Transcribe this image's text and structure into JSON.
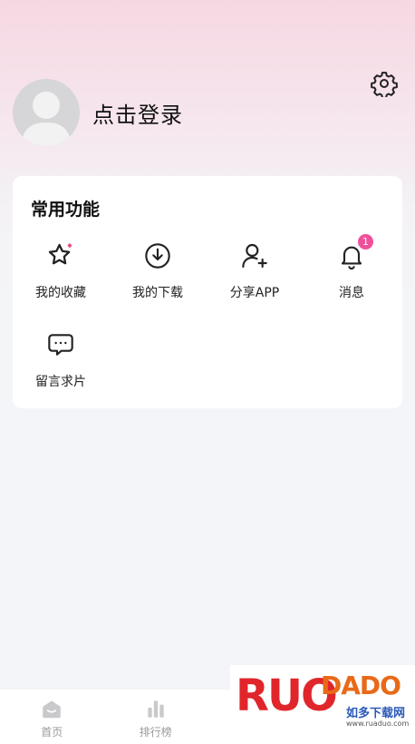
{
  "profile": {
    "login_text": "点击登录"
  },
  "common": {
    "title": "常用功能",
    "items": [
      {
        "label": "我的收藏",
        "icon": "star-icon"
      },
      {
        "label": "我的下载",
        "icon": "download-icon"
      },
      {
        "label": "分享APP",
        "icon": "share-user-icon"
      },
      {
        "label": "消息",
        "icon": "bell-icon",
        "badge": "1"
      },
      {
        "label": "留言求片",
        "icon": "message-icon"
      }
    ]
  },
  "tabbar": {
    "items": [
      {
        "label": "首页",
        "icon": "home-icon"
      },
      {
        "label": "排行榜",
        "icon": "chart-icon"
      }
    ]
  },
  "watermark": {
    "logo_left": "RUO",
    "logo_right": "DADO",
    "subtitle": "如多下载网",
    "url": "www.ruaduo.com"
  },
  "colors": {
    "badge": "#f0509a",
    "accent_gradient": "#f6d8e2"
  }
}
